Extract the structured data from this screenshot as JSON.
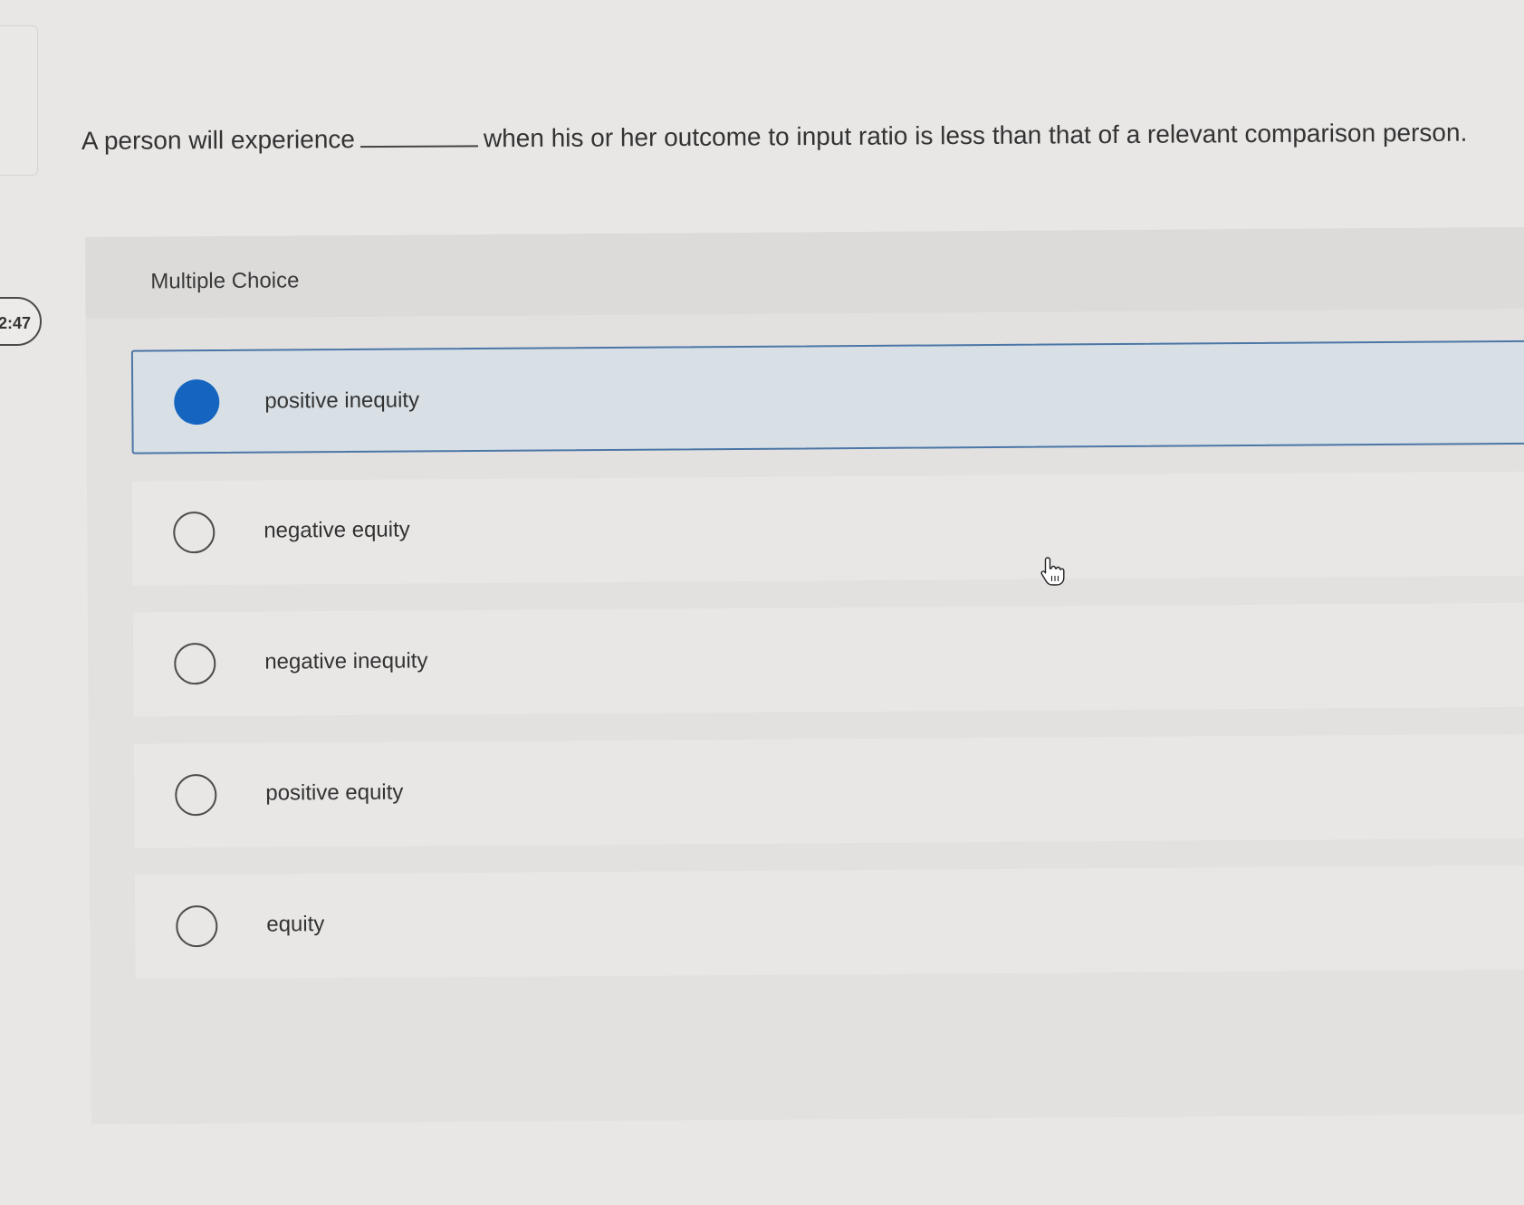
{
  "timer": {
    "label": "2:47"
  },
  "question": {
    "before_blank": "A person will experience",
    "after_blank": "when his or her outcome to input ratio is less than that of a relevant comparison person."
  },
  "multiple_choice": {
    "title": "Multiple Choice",
    "options": [
      {
        "label": "positive inequity",
        "selected": true
      },
      {
        "label": "negative equity",
        "selected": false
      },
      {
        "label": "negative inequity",
        "selected": false
      },
      {
        "label": "positive equity",
        "selected": false
      },
      {
        "label": "equity",
        "selected": false
      }
    ]
  },
  "colors": {
    "selected_radio": "#1565c0",
    "selected_border": "#4b76a6",
    "selected_background": "#d8e0e6"
  },
  "icons": {
    "cursor": "hand-pointer-icon"
  }
}
